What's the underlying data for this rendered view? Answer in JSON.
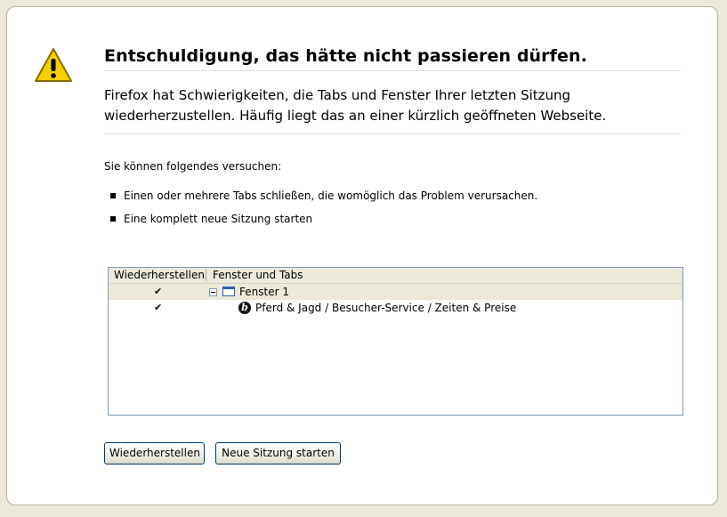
{
  "page": {
    "title": "Entschuldigung, das hätte nicht passieren dürfen.",
    "description": "Firefox hat Schwierigkeiten, die Tabs und Fenster Ihrer letzten Sitzung wiederherzustellen. Häufig liegt das an einer kürzlich geöffneten Webseite.",
    "try_label": "Sie können folgendes versuchen:",
    "suggestions": [
      "Einen oder mehrere Tabs schließen, die womöglich das Problem verursachen.",
      "Eine komplett neue Sitzung starten"
    ]
  },
  "tree": {
    "columns": {
      "restore": "Wiederherstellen",
      "windows": "Fenster und Tabs"
    },
    "rows": [
      {
        "checked": true,
        "label": "Fenster 1",
        "icon": "window-icon",
        "expanded": true
      },
      {
        "checked": true,
        "label": "Pferd & Jagd / Besucher-Service / Zeiten & Preise",
        "icon": "site-favicon"
      }
    ]
  },
  "buttons": {
    "restore": "Wiederherstellen",
    "new_session": "Neue Sitzung starten"
  },
  "icons": {
    "warning": "warning-triangle-icon",
    "check": "checkmark-icon"
  },
  "colors": {
    "background": "#ECE9D8",
    "tree_border": "#7F9DB9",
    "button_border": "#003C74",
    "window_icon": "#2C5FB8"
  }
}
